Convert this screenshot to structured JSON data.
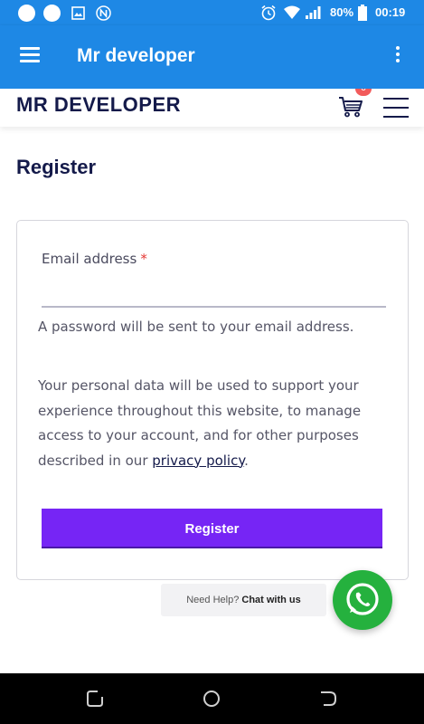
{
  "status_bar": {
    "battery_percent": "80%",
    "time": "00:19",
    "icons": [
      "circle-icon",
      "circle-icon",
      "image-icon",
      "n-icon",
      "alarm-icon",
      "wifi-icon",
      "signal-icon",
      "battery-icon"
    ]
  },
  "app_bar": {
    "title": "Mr developer",
    "menu_icon": "hamburger-icon",
    "overflow_icon": "more-vert-icon"
  },
  "site_header": {
    "logo": "MR DEVELOPER",
    "cart_count": "0",
    "cart_icon": "cart-icon",
    "menu_icon": "hamburger-icon"
  },
  "register": {
    "title": "Register",
    "email_label": "Email address",
    "required_mark": "*",
    "email_value": "",
    "password_note": "A password will be sent to your email address.",
    "privacy_text_before": "Your personal data will be used to support your experience throughout this website, to manage access to your account, and for other purposes described in our ",
    "privacy_link": "privacy policy",
    "privacy_text_after": ".",
    "button_label": "Register"
  },
  "help_chip": {
    "prefix": "Need Help?",
    "action": "Chat with us"
  },
  "colors": {
    "primary": "#1e88e5",
    "brand_navy": "#141a4a",
    "button": "#7625f5",
    "whatsapp": "#25b13e",
    "badge": "#f25b5b",
    "required": "#e53935"
  },
  "nav_bar": {
    "icons": [
      "recent-apps-icon",
      "home-icon",
      "back-icon"
    ]
  }
}
